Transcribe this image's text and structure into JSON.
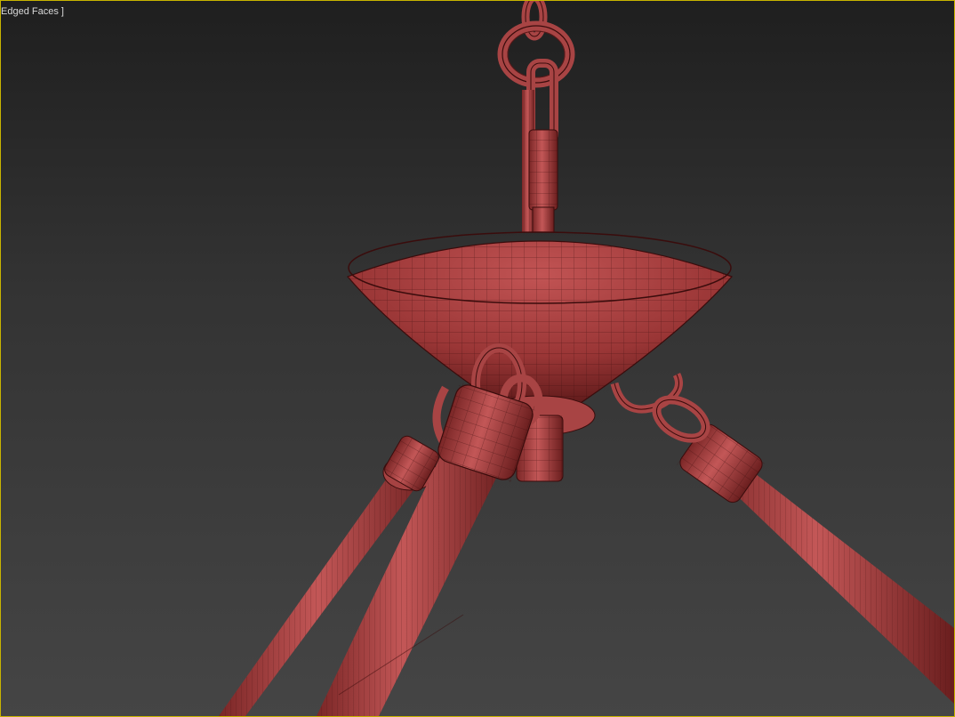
{
  "viewport": {
    "label": "Edged Faces ]",
    "border_color": "#c8b400",
    "background_top": "#1f1f1f",
    "background_bottom": "#454545"
  },
  "model": {
    "fill_color": "#b34a4a",
    "shade_color": "#6e1f1f",
    "wire_color": "#3a0c0c"
  }
}
